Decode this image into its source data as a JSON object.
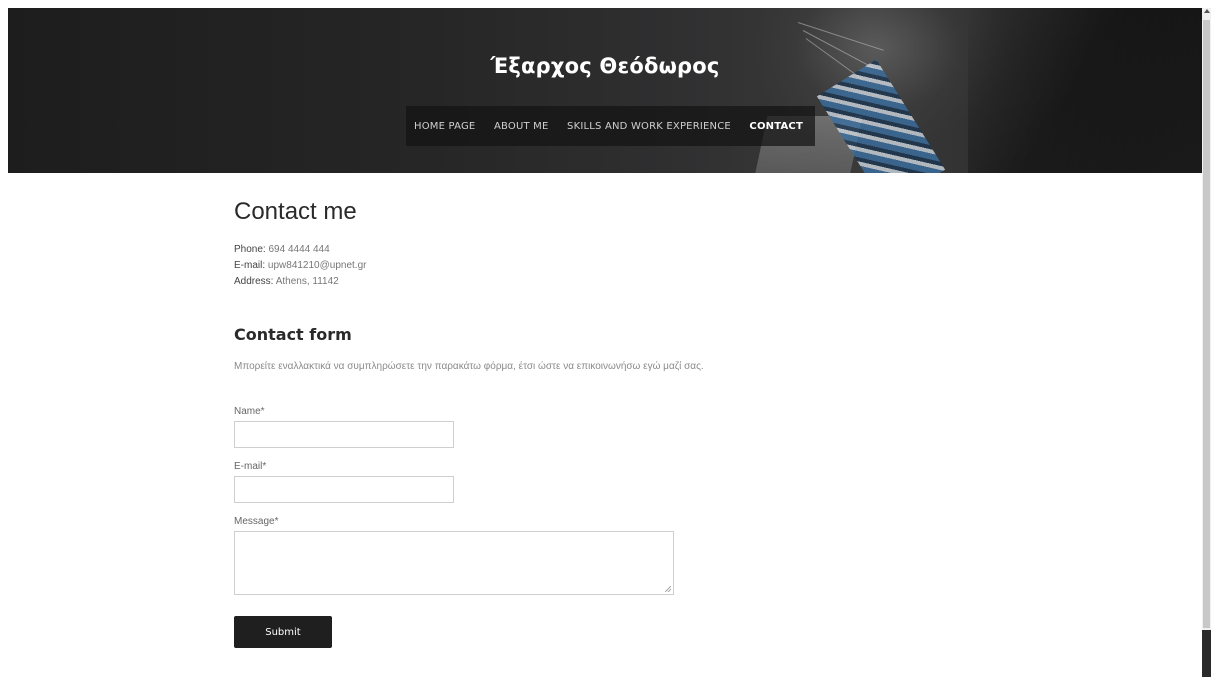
{
  "site": {
    "title": "Έξαρχος Θεόδωρος"
  },
  "nav": {
    "items": [
      {
        "label": "HOME PAGE",
        "active": false
      },
      {
        "label": "ABOUT ME",
        "active": false
      },
      {
        "label": "SKILLS AND WORK EXPERIENCE",
        "active": false
      },
      {
        "label": "CONTACT",
        "active": true
      }
    ]
  },
  "contact": {
    "title": "Contact me",
    "phone_label": "Phone:",
    "phone_value": "694 4444 444",
    "email_label": "E-mail:",
    "email_value": "upw841210@upnet.gr",
    "address_label": "Address:",
    "address_value": "Athens, 11142"
  },
  "form": {
    "title": "Contact form",
    "intro": "Μπορείτε εναλλακτικά να συμπληρώσετε την παρακάτω φόρμα, έτσι ώστε να επικοινωνήσω εγώ μαζί σας.",
    "name_label": "Name*",
    "name_value": "",
    "email_label": "E-mail*",
    "email_value": "",
    "message_label": "Message*",
    "message_value": "",
    "submit_label": "Submit"
  },
  "colors": {
    "header_bg": "#262626",
    "button_bg": "#1f1f1f",
    "text_dark": "#2a2a2a",
    "text_muted": "#8a8a8a"
  }
}
